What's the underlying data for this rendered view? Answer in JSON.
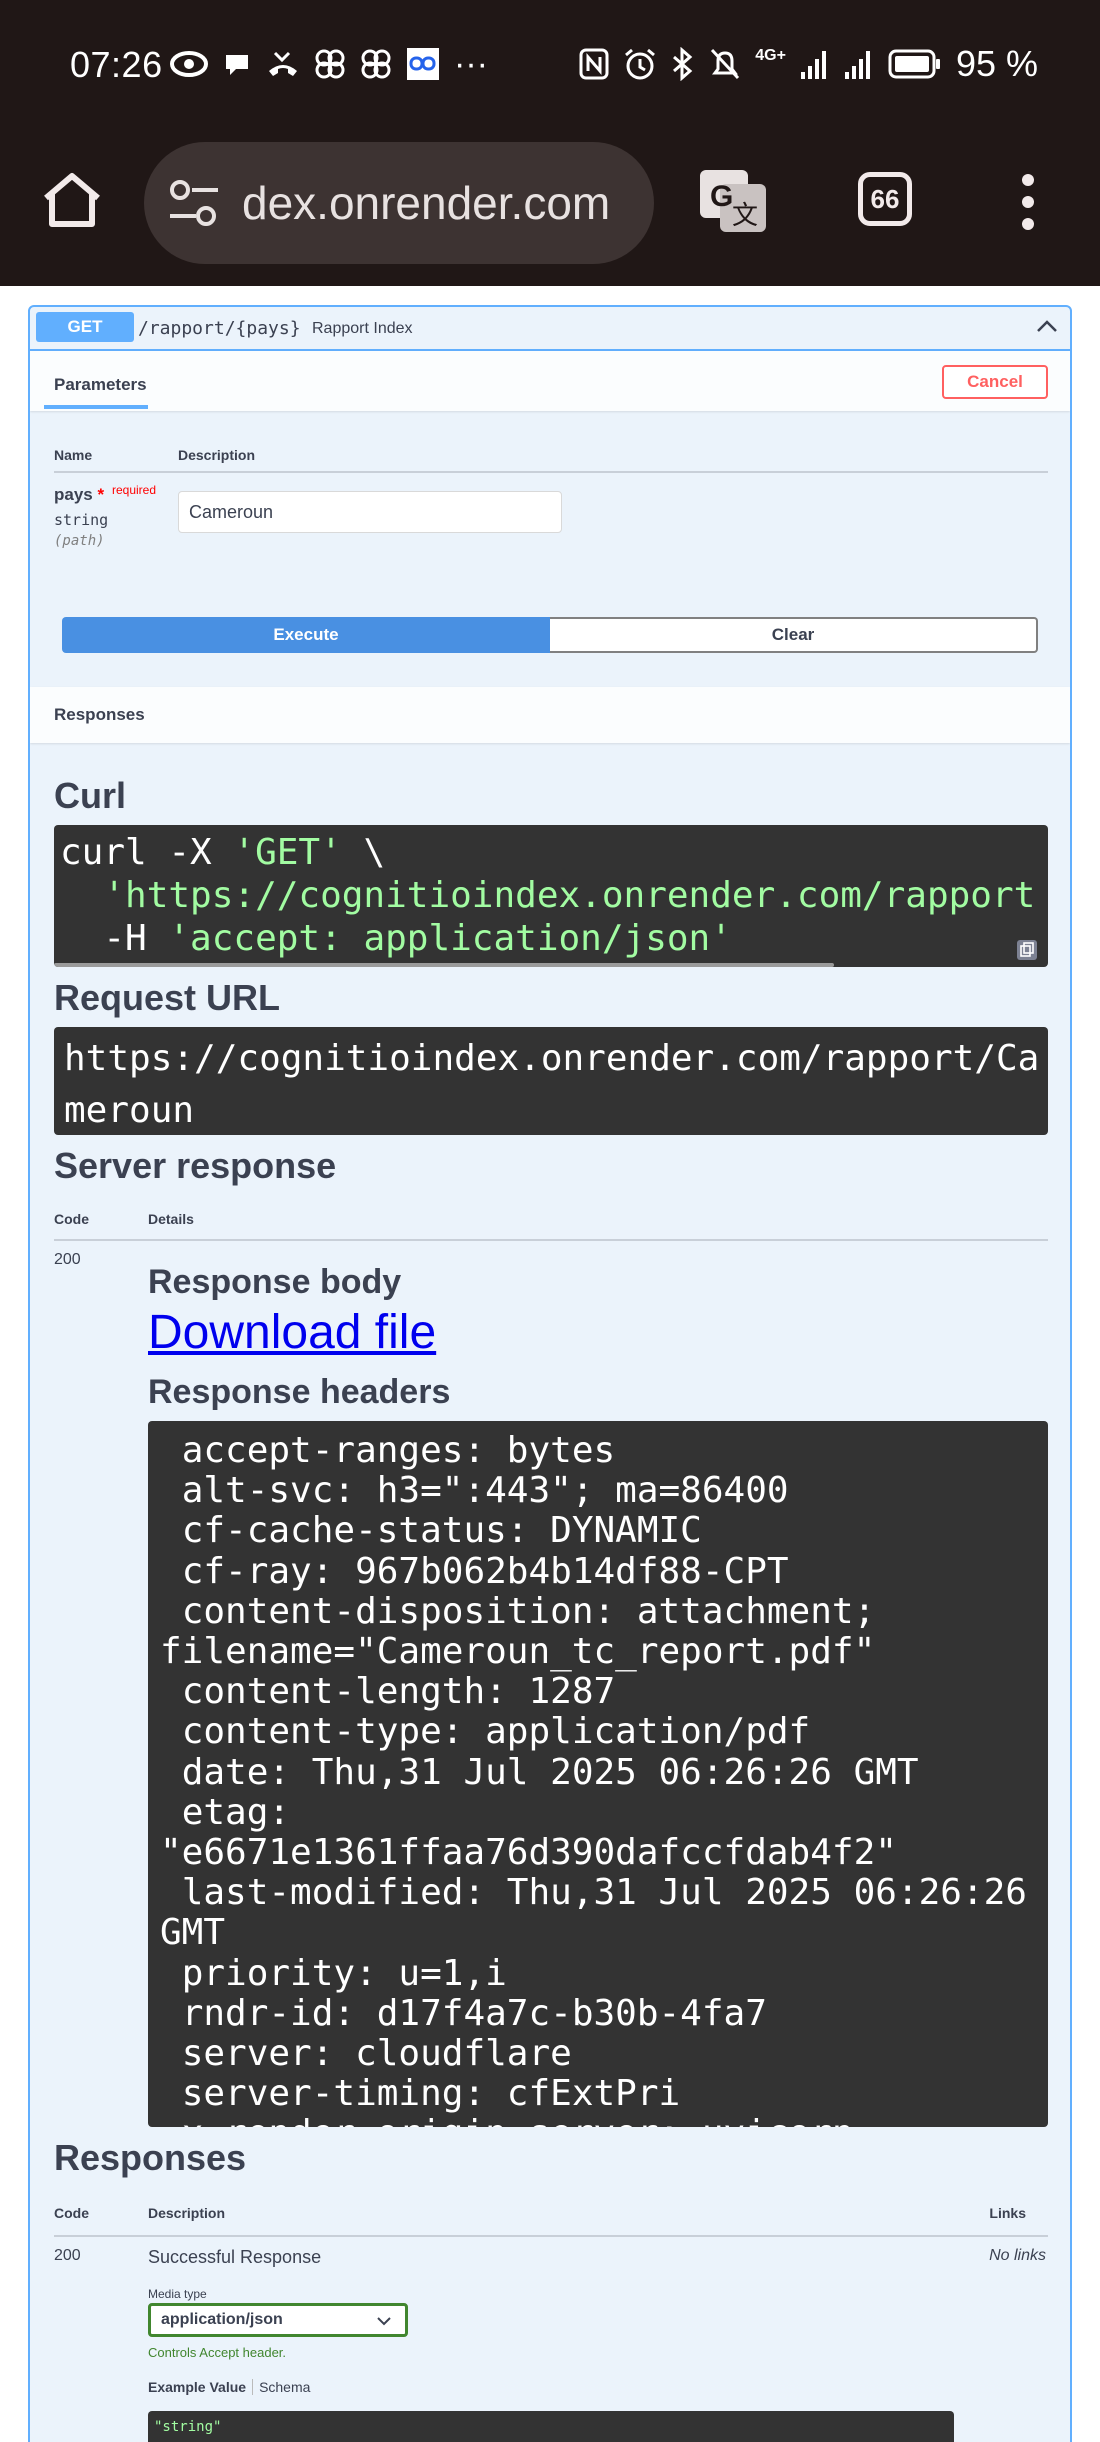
{
  "status_bar": {
    "time": "07:26",
    "overflow_indicator": "···",
    "network_label": "4G+",
    "battery_text": "95 %",
    "left_icons": [
      "eye-icon",
      "chat-bubble-icon",
      "missed-call-icon",
      "pinwheel-icon",
      "pinwheel-icon",
      "link-app-icon"
    ],
    "right_icons": [
      "nfc-icon",
      "alarm-icon",
      "bluetooth-icon",
      "silent-icon",
      "signal-icon",
      "signal-icon",
      "battery-icon"
    ]
  },
  "browser": {
    "url_display": "dex.onrender.com",
    "tab_count": "66",
    "icons": [
      "home-icon",
      "site-settings-icon",
      "translate-icon",
      "tabs-icon",
      "more-vert-icon"
    ]
  },
  "operation": {
    "method": "GET",
    "path": "/rapport/{pays}",
    "summary": "Rapport Index"
  },
  "parameters": {
    "tab_label": "Parameters",
    "cancel_label": "Cancel",
    "col_name": "Name",
    "col_description": "Description",
    "param_name": "pays",
    "required_star": "*",
    "required_label": "required",
    "param_type": "string",
    "param_in": "(path)",
    "param_value": "Cameroun"
  },
  "actions": {
    "execute_label": "Execute",
    "clear_label": "Clear"
  },
  "responses_header": "Responses",
  "curl": {
    "title": "Curl",
    "line1_cmd": "curl -X ",
    "line1_method": "'GET'",
    "line1_cont": " \\",
    "line2": "  'https://cognitioindex.onrender.com/rapport",
    "line3_flag": "  -H ",
    "line3_value": "'accept: application/json'"
  },
  "request_url": {
    "title": "Request URL",
    "value": "https://cognitioindex.onrender.com/rapport/Cameroun"
  },
  "server_response": {
    "title": "Server response",
    "col_code": "Code",
    "col_details": "Details",
    "code": "200",
    "body_title": "Response body",
    "download_label": "Download file",
    "headers_title": "Response headers",
    "headers_text": " accept-ranges: bytes\n alt-svc: h3=\":443\"; ma=86400\n cf-cache-status: DYNAMIC\n cf-ray: 967b062b4b14df88-CPT\n content-disposition: attachment;\nfilename=\"Cameroun_tc_report.pdf\"\n content-length: 1287\n content-type: application/pdf\n date: Thu,31 Jul 2025 06:26:26 GMT\n etag: \"e6671e1361ffaa76d390dafccfdab4f2\"\n last-modified: Thu,31 Jul 2025 06:26:26\nGMT\n priority: u=1,i\n rndr-id: d17f4a7c-b30b-4fa7\n server: cloudflare\n server-timing: cfExtPri\n x-render-origin-server: uvicorn"
  },
  "responses": {
    "title": "Responses",
    "col_code": "Code",
    "col_description": "Description",
    "col_links": "Links",
    "code": "200",
    "description": "Successful Response",
    "links": "No links",
    "media_type_label": "Media type",
    "media_type_value": "application/json",
    "controls_note": "Controls Accept header.",
    "example_value_tab": "Example Value",
    "schema_tab": "Schema",
    "example_value": "\"string\""
  },
  "colors": {
    "get_blue": "#61affe",
    "execute_blue": "#4990e2",
    "cancel_red": "#ff6060",
    "code_bg": "#333333",
    "string_green": "#a2fca2",
    "select_green": "#41862f",
    "chrome_dark": "#201716"
  }
}
